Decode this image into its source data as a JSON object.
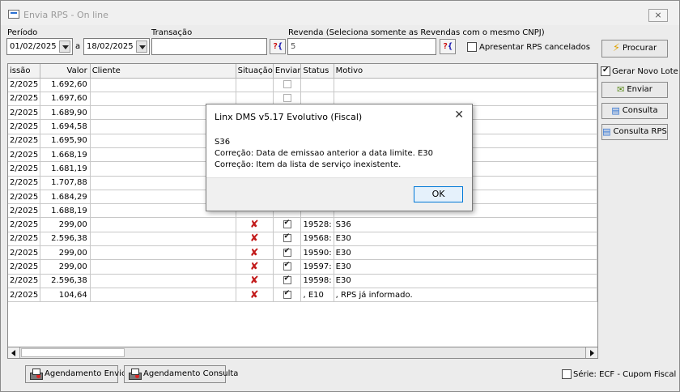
{
  "window": {
    "title": "Envia RPS - On line",
    "close": "⨯"
  },
  "filters": {
    "periodo_label": "Período",
    "date_from": "01/02/2025",
    "sep": "a",
    "date_to": "18/02/2025",
    "transacao_label": "Transação",
    "transacao_value": "",
    "revenda_label": "Revenda (Seleciona somente as Revendas com o mesmo CNPJ)",
    "revenda_value": "5",
    "apresentar_label": "Apresentar RPS cancelados",
    "apresentar_checked": false
  },
  "side": {
    "procurar": "Procurar",
    "gerar_label": "Gerar Novo Lote",
    "gerar_checked": true,
    "enviar": "Enviar",
    "consulta": "Consulta",
    "consulta_rps": "Consulta RPS"
  },
  "table": {
    "headers": [
      "issão",
      "Valor",
      "Cliente",
      "Situação",
      "Enviar",
      "Status",
      "Motivo"
    ],
    "rows": [
      {
        "emissao": "2/2025",
        "valor": "1.692,60",
        "situacao": "",
        "enviar": "empty",
        "status": "",
        "motivo": ""
      },
      {
        "emissao": "2/2025",
        "valor": "1.697,60",
        "situacao": "",
        "enviar": "empty",
        "status": "",
        "motivo": ""
      },
      {
        "emissao": "2/2025",
        "valor": "1.689,90",
        "situacao": "",
        "enviar": "",
        "status": "",
        "motivo": ""
      },
      {
        "emissao": "2/2025",
        "valor": "1.694,58",
        "situacao": "",
        "enviar": "",
        "status": "",
        "motivo": ""
      },
      {
        "emissao": "2/2025",
        "valor": "1.695,90",
        "situacao": "",
        "enviar": "",
        "status": "",
        "motivo": ""
      },
      {
        "emissao": "2/2025",
        "valor": "1.668,19",
        "situacao": "",
        "enviar": "",
        "status": "",
        "motivo": ""
      },
      {
        "emissao": "2/2025",
        "valor": "1.681,19",
        "situacao": "",
        "enviar": "",
        "status": "",
        "motivo": ""
      },
      {
        "emissao": "2/2025",
        "valor": "1.707,88",
        "situacao": "",
        "enviar": "",
        "status": "",
        "motivo": ""
      },
      {
        "emissao": "2/2025",
        "valor": "1.684,29",
        "situacao": "",
        "enviar": "",
        "status": "",
        "motivo": ""
      },
      {
        "emissao": "2/2025",
        "valor": "1.688,19",
        "situacao": "",
        "enviar": "",
        "status": "",
        "motivo": ""
      },
      {
        "emissao": "2/2025",
        "valor": "299,00",
        "situacao": "x",
        "enviar": "checked",
        "status": "19528:",
        "motivo": "S36"
      },
      {
        "emissao": "2/2025",
        "valor": "2.596,38",
        "situacao": "x",
        "enviar": "checked",
        "status": "19568:",
        "motivo": "E30"
      },
      {
        "emissao": "2/2025",
        "valor": "299,00",
        "situacao": "x",
        "enviar": "checked",
        "status": "19590:",
        "motivo": "E30"
      },
      {
        "emissao": "2/2025",
        "valor": "299,00",
        "situacao": "x",
        "enviar": "checked",
        "status": "19597:",
        "motivo": "E30"
      },
      {
        "emissao": "2/2025",
        "valor": "2.596,38",
        "situacao": "x",
        "enviar": "checked",
        "status": "19598:",
        "motivo": "E30"
      },
      {
        "emissao": "2/2025",
        "valor": "104,64",
        "situacao": "x",
        "enviar": "checked",
        "status": ", E10",
        "motivo": ", RPS já informado."
      }
    ]
  },
  "bottom": {
    "agendamento_envio": "Agendamento Envio",
    "agendamento_consulta": "Agendamento Consulta",
    "serie_label": "Série: ECF - Cupom Fiscal",
    "serie_checked": false
  },
  "dialog": {
    "title": "Linx DMS v5.17 Evolutivo (Fiscal)",
    "close": "✕",
    "message": "S36\nCorreção: Data de emissao anterior a data limite. E30\nCorreção: Item da lista de serviço inexistente.",
    "ok": "OK"
  },
  "colors": {
    "error_x": "#c21a1a",
    "ok_border": "#0078d7"
  }
}
